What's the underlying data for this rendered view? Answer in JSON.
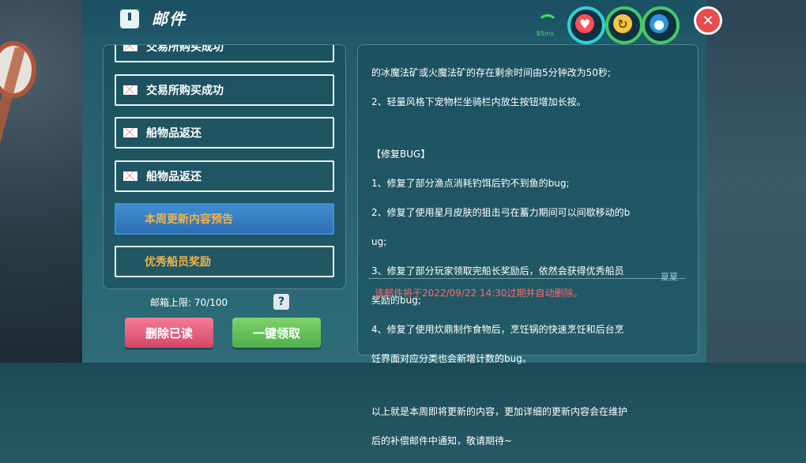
{
  "header": {
    "title": "邮件"
  },
  "status": {
    "signal_label": "85ms",
    "heart_icon": "heart-icon",
    "stamina_icon": "stamina-icon",
    "water_icon": "water-drop-icon"
  },
  "mail_list": {
    "items": [
      {
        "label": "交易所购买成功"
      },
      {
        "label": "交易所购买成功"
      },
      {
        "label": "船物品返还"
      },
      {
        "label": "船物品返还"
      },
      {
        "label": "本周更新内容预告",
        "selected": true
      },
      {
        "label": "优秀船员奖励"
      }
    ]
  },
  "mailbox": {
    "limit_label": "邮箱上限:",
    "count": "70/100",
    "help_label": "?"
  },
  "buttons": {
    "delete_read": "删除已读",
    "claim_all": "一键领取"
  },
  "content": {
    "lines": [
      "的冰魔法矿或火魔法矿的存在剩余时间由5分钟改为50秒;",
      "2、轻量风格下宠物栏坐骑栏内放生按钮增加长按。",
      "",
      "【修复BUG】",
      "1、修复了部分渔点消耗钓饵后钓不到鱼的bug;",
      "2、修复了使用星月皮肤的狙击弓在蓄力期间可以间歇移动的b",
      "ug;",
      "3、修复了部分玩家领取完船长奖励后，依然会获得优秀船员",
      "奖励的bug;",
      "4、修复了使用炊鼎制作食物后，烹饪锅的快速烹饪和后台烹",
      "饪界面对应分类也会新增计数的bug。",
      "",
      "以上就是本周即将更新的内容，更加详细的更新内容会在维护",
      "后的补偿邮件中通知，敬请期待~"
    ],
    "signature": "夏夏",
    "expire_notice": "该邮件将于2022/09/22 14:30过期并自动删除。"
  },
  "colors": {
    "accent_orange": "#f0b34a",
    "selected_blue": "#3f8ed0",
    "warning_red": "#ff6a6a"
  }
}
